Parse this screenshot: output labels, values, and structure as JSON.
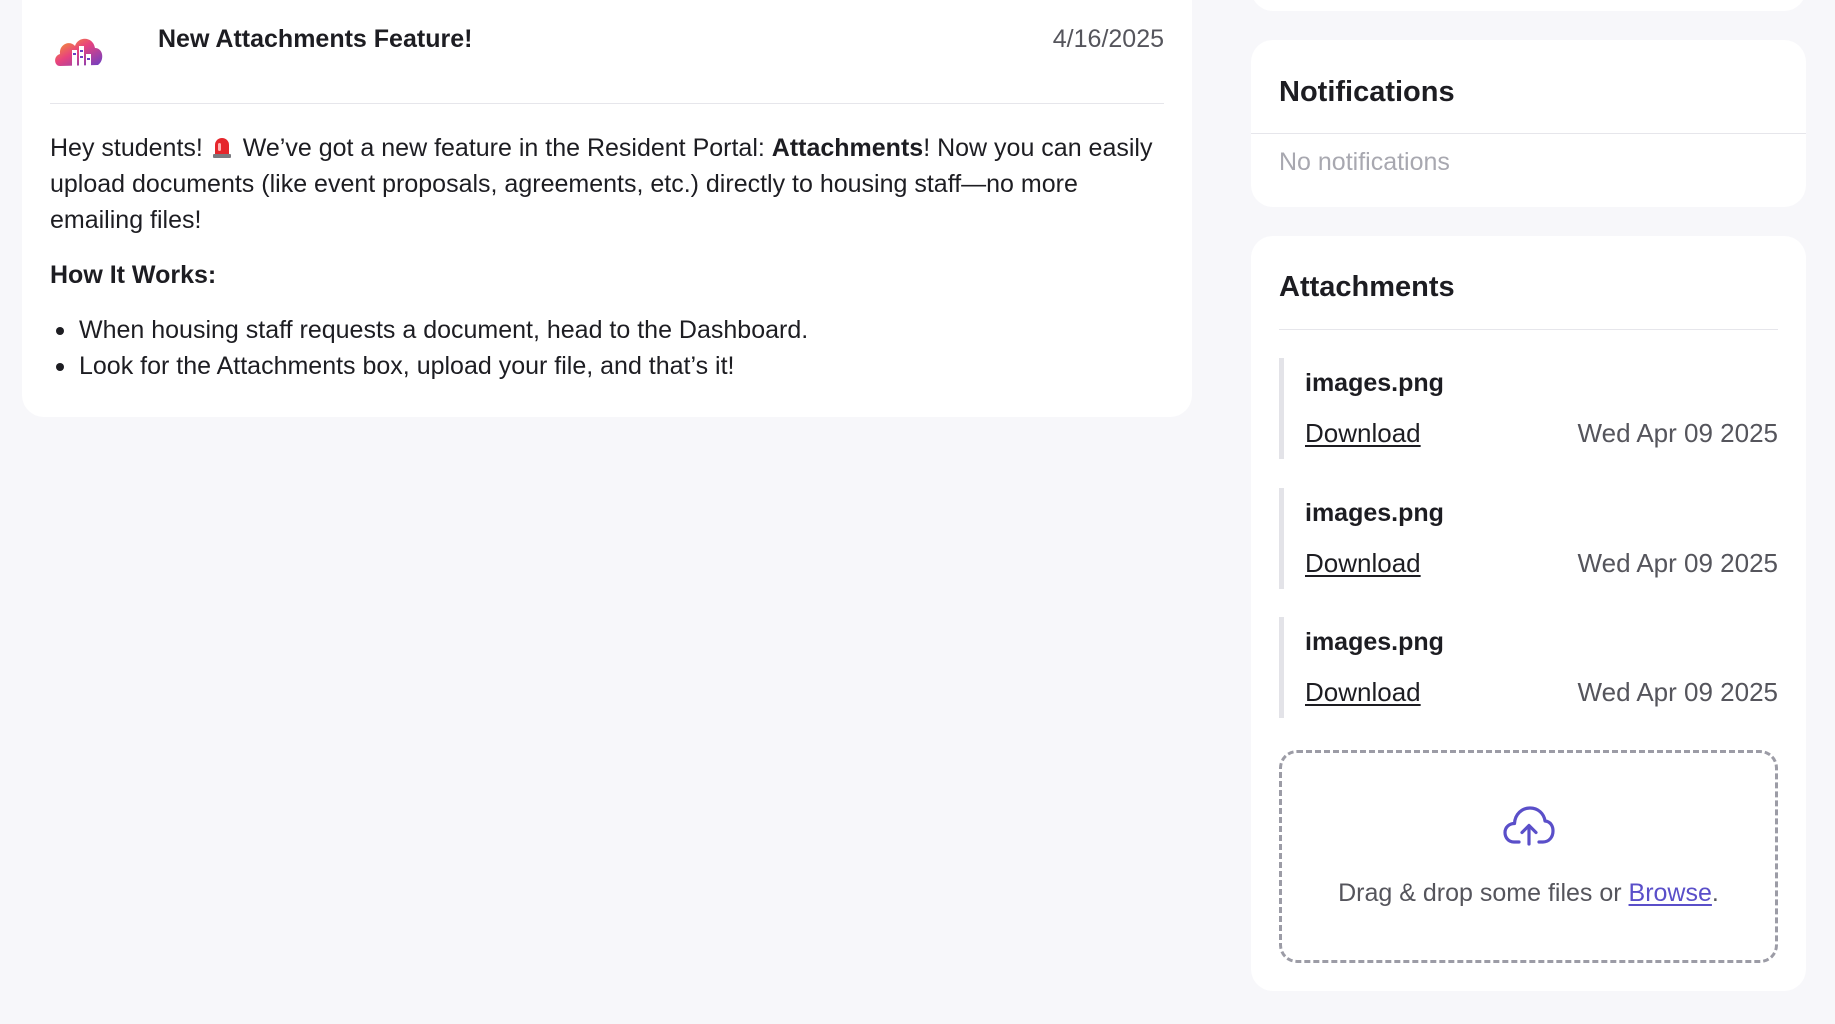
{
  "announcement": {
    "title": "New Attachments Feature!",
    "date": "4/16/2025",
    "intro_before_alarm": "Hey students! ",
    "intro_after_alarm": " We’ve got a new feature in the Resident Portal: ",
    "intro_bold": "Attachments",
    "intro_rest": "! Now you can easily upload documents (like event proposals, agreements, etc.) directly to housing staff—no more emailing files!",
    "how_heading": "How It Works:",
    "bullets": [
      "When housing staff requests a document, head to the Dashboard.",
      "Look for the Attachments box, upload your file, and that’s it!"
    ],
    "icons": {
      "logo": "building-cloud-logo-icon",
      "alarm": "rotating-light-emoji-icon"
    }
  },
  "notifications": {
    "title": "Notifications",
    "empty_text": "No notifications"
  },
  "attachments": {
    "title": "Attachments",
    "files": [
      {
        "name": "images.png",
        "download_label": "Download",
        "date": "Wed Apr 09 2025"
      },
      {
        "name": "images.png",
        "download_label": "Download",
        "date": "Wed Apr 09 2025"
      },
      {
        "name": "images.png",
        "download_label": "Download",
        "date": "Wed Apr 09 2025"
      }
    ],
    "dropzone": {
      "text_before": "Drag & drop some files or ",
      "browse_label": "Browse",
      "text_after": ".",
      "icon": "cloud-upload-icon"
    }
  },
  "colors": {
    "page_background": "#f7f7fa",
    "card_background": "#ffffff",
    "accent": "#5a4fc9",
    "muted_text": "#a8a8b0"
  }
}
